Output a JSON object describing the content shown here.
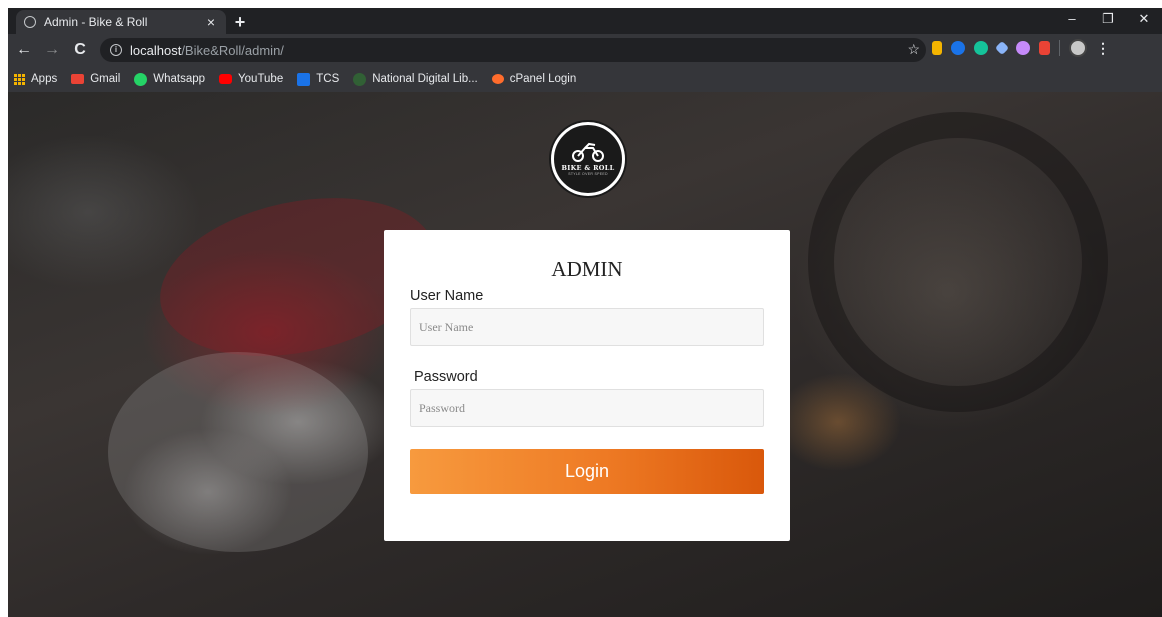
{
  "browser": {
    "tab": {
      "title": "Admin - Bike & Roll",
      "close_glyph": "×",
      "icon": "globe-icon"
    },
    "new_tab_glyph": "+",
    "window_controls": {
      "minimize": "–",
      "restore": "❐",
      "close": "✕"
    },
    "nav": {
      "back": "←",
      "forward": "→",
      "reload": "C"
    },
    "address": {
      "host": "localhost",
      "path": "/Bike&Roll/admin/",
      "info_glyph": "i"
    },
    "star_glyph": "☆",
    "menu_glyph": "⋮",
    "extensions": [
      {
        "name": "reader-extension-icon",
        "color": "#f4b400"
      },
      {
        "name": "blue-extension-icon",
        "color": "#1a73e8"
      },
      {
        "name": "grammarly-extension-icon",
        "color": "#15c39a"
      },
      {
        "name": "dropbox-extension-icon",
        "color": "#8ab4f8"
      },
      {
        "name": "owl-extension-icon",
        "color": "#c58af9"
      },
      {
        "name": "office-extension-icon",
        "color": "#ea4335"
      }
    ]
  },
  "bookmarks": [
    {
      "label": "Apps",
      "icon": "apps-grid-icon",
      "color": "#f4b400"
    },
    {
      "label": "Gmail",
      "icon": "gmail-icon",
      "color": "#ea4335"
    },
    {
      "label": "Whatsapp",
      "icon": "whatsapp-icon",
      "color": "#25d366"
    },
    {
      "label": "YouTube",
      "icon": "youtube-icon",
      "color": "#ff0000"
    },
    {
      "label": "TCS",
      "icon": "tcs-icon",
      "color": "#1a73e8"
    },
    {
      "label": "National Digital Lib...",
      "icon": "ndl-icon",
      "color": "#2e7d32"
    },
    {
      "label": "cPanel Login",
      "icon": "cpanel-icon",
      "color": "#ff6c2c"
    }
  ],
  "logo": {
    "text": "BIKE & ROLL",
    "subtitle": "STYLE OVER SPEED"
  },
  "login": {
    "title": "ADMIN",
    "username_label": "User Name",
    "username_placeholder": "User Name",
    "username_value": "",
    "password_label": "Password",
    "password_placeholder": "Password",
    "password_value": "",
    "button_label": "Login"
  },
  "colors": {
    "button_gradient_start": "#f79a3e",
    "button_gradient_end": "#d9580b"
  }
}
